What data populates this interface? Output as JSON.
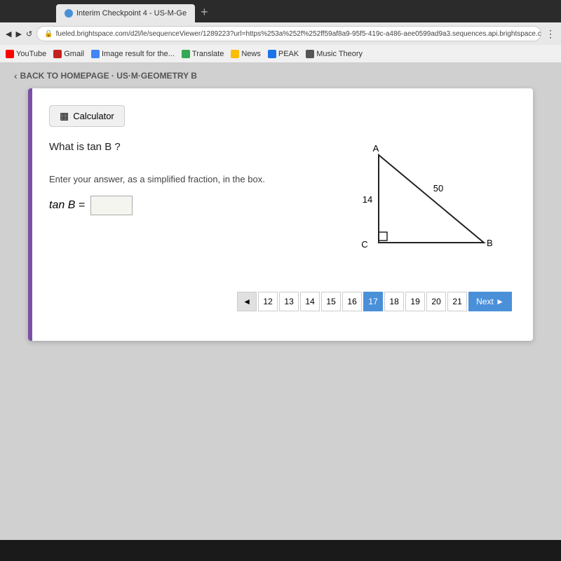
{
  "browser": {
    "tab_title": "Interim Checkpoint 4 - US-M-Ge",
    "address": "fueled.brightspace.com/d2l/le/sequenceViewer/1289223?url=https%253a%252f%252ff59af8a9-95f5-419c-a486-aee0599ad9a3.sequences.api.brightspace.com%25",
    "bookmarks": [
      {
        "label": "YouTube",
        "color": "red"
      },
      {
        "label": "Gmail",
        "color": "#c5221f"
      },
      {
        "label": "Image result for the...",
        "color": "#4285f4"
      },
      {
        "label": "Translate",
        "color": "#34a853"
      },
      {
        "label": "News",
        "color": "#fbbc04"
      },
      {
        "label": "PEAK",
        "color": "#1a73e8"
      },
      {
        "label": "Music Theory",
        "color": "#555"
      }
    ]
  },
  "nav": {
    "back_label": "BACK TO HOMEPAGE · US·M·GEOMETRY B"
  },
  "card": {
    "calculator_label": "Calculator",
    "question": "What is tan B ?",
    "answer_instruction": "Enter your answer, as a simplified fraction, in the box.",
    "tan_label": "tan B =",
    "triangle": {
      "vertex_a": "A",
      "vertex_b": "B",
      "vertex_c": "C",
      "side_ac": "14",
      "side_ab": "50"
    }
  },
  "pagination": {
    "prev_arrow": "◄",
    "pages": [
      "12",
      "13",
      "14",
      "15",
      "16",
      "17",
      "18",
      "19",
      "20",
      "21"
    ],
    "active_page": "17",
    "next_label": "Next ►"
  }
}
